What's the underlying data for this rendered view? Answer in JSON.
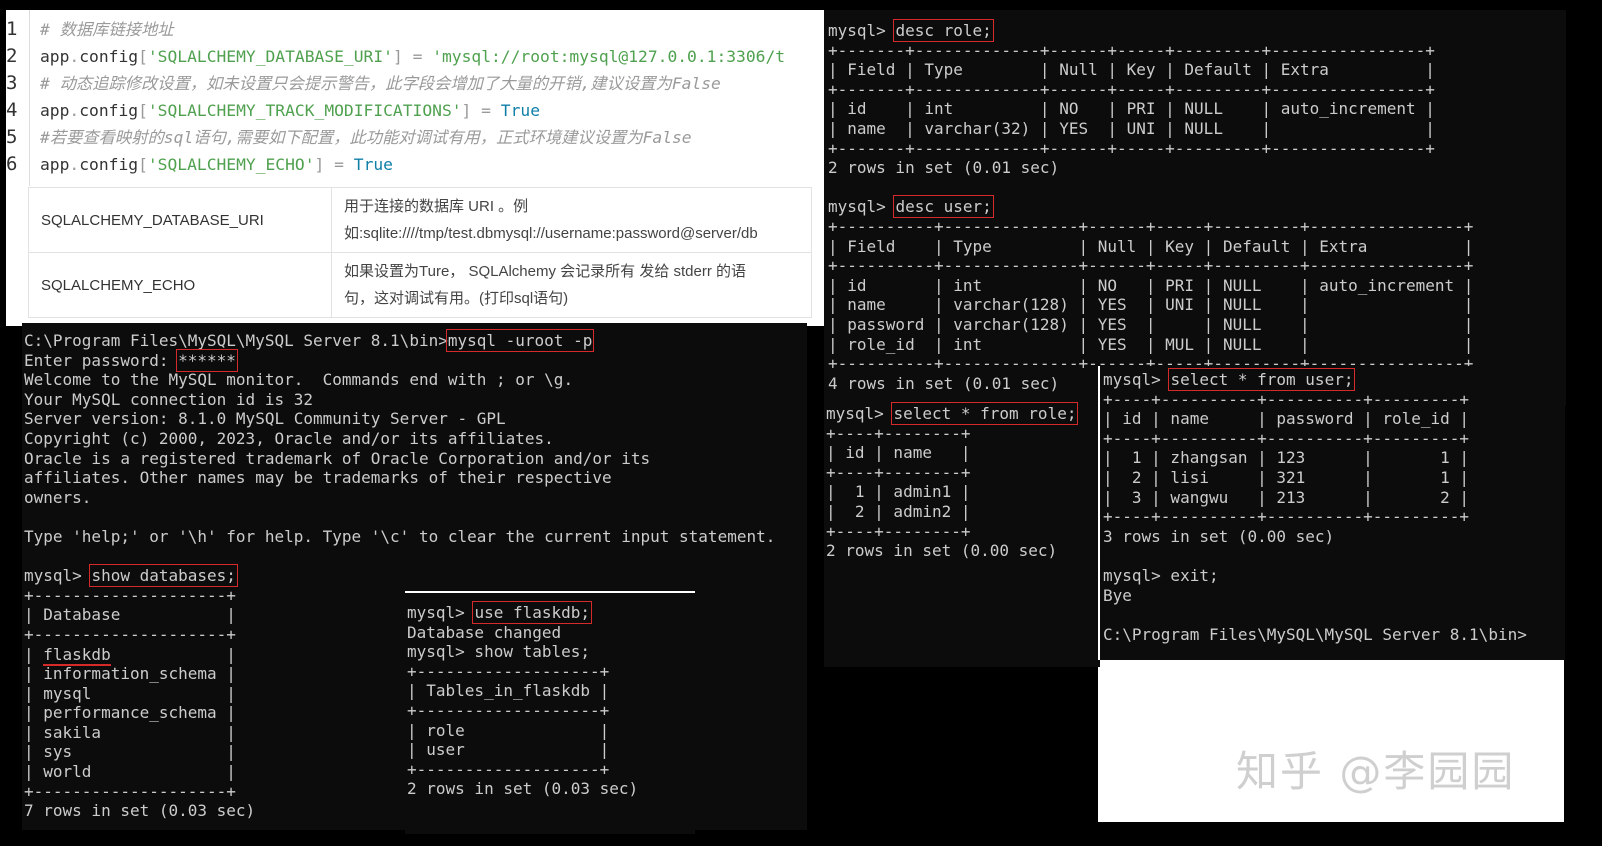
{
  "code": {
    "lines": [
      {
        "n": "1",
        "parts": [
          {
            "c": "c",
            "t": "# 数据库链接地址"
          }
        ]
      },
      {
        "n": "2",
        "parts": [
          {
            "c": "k",
            "t": "app"
          },
          {
            "c": "p",
            "t": "."
          },
          {
            "c": "k",
            "t": "config"
          },
          {
            "c": "p",
            "t": "["
          },
          {
            "c": "s",
            "t": "'SQLALCHEMY_DATABASE_URI'"
          },
          {
            "c": "p",
            "t": "]"
          },
          {
            "c": "k",
            "t": " "
          },
          {
            "c": "p",
            "t": "="
          },
          {
            "c": "k",
            "t": " "
          },
          {
            "c": "s",
            "t": "'mysql://root:mysql@127.0.0.1:3306/t"
          }
        ]
      },
      {
        "n": "3",
        "parts": [
          {
            "c": "c",
            "t": "# 动态追踪修改设置，如未设置只会提示警告，此字段会增加了大量的开销,建议设置为False"
          }
        ]
      },
      {
        "n": "4",
        "parts": [
          {
            "c": "k",
            "t": "app"
          },
          {
            "c": "p",
            "t": "."
          },
          {
            "c": "k",
            "t": "config"
          },
          {
            "c": "p",
            "t": "["
          },
          {
            "c": "s",
            "t": "'SQLALCHEMY_TRACK_MODIFICATIONS'"
          },
          {
            "c": "p",
            "t": "]"
          },
          {
            "c": "k",
            "t": " "
          },
          {
            "c": "p",
            "t": "="
          },
          {
            "c": "k",
            "t": " "
          },
          {
            "c": "b",
            "t": "True"
          }
        ]
      },
      {
        "n": "5",
        "parts": [
          {
            "c": "c",
            "t": "#若要查看映射的sql语句,需要如下配置，此功能对调试有用，正式环境建议设置为False"
          }
        ]
      },
      {
        "n": "6",
        "parts": [
          {
            "c": "k",
            "t": "app"
          },
          {
            "c": "p",
            "t": "."
          },
          {
            "c": "k",
            "t": "config"
          },
          {
            "c": "p",
            "t": "["
          },
          {
            "c": "s",
            "t": "'SQLALCHEMY_ECHO'"
          },
          {
            "c": "p",
            "t": "]"
          },
          {
            "c": "k",
            "t": " "
          },
          {
            "c": "p",
            "t": "="
          },
          {
            "c": "k",
            "t": " "
          },
          {
            "c": "b",
            "t": "True"
          }
        ]
      }
    ]
  },
  "config_table": [
    {
      "key": "SQLALCHEMY_DATABASE_URI",
      "desc1": "用于连接的数据库 URI 。例",
      "desc2": "如:sqlite:////tmp/test.dbmysql://username:password@server/db"
    },
    {
      "key": "SQLALCHEMY_ECHO",
      "desc1": "如果设置为Ture， SQLAlchemy 会记录所有 发给 stderr 的语",
      "desc2": "句，这对调试有用。(打印sql语句)"
    }
  ],
  "terminals": {
    "login": [
      {
        "t": "C:\\Program Files\\MySQL\\MySQL Server 8.1\\bin>",
        "h": "mysql -uroot -p"
      },
      {
        "t": "Enter password: ",
        "h": "******"
      },
      {
        "t": "Welcome to the MySQL monitor.  Commands end with ; or \\g."
      },
      {
        "t": "Your MySQL connection id is 32"
      },
      {
        "t": "Server version: 8.1.0 MySQL Community Server - GPL"
      },
      {
        "t": "Copyright (c) 2000, 2023, Oracle and/or its affiliates."
      },
      {
        "t": "Oracle is a registered trademark of Oracle Corporation and/or its"
      },
      {
        "t": "affiliates. Other names may be trademarks of their respective"
      },
      {
        "t": "owners."
      },
      {
        "t": ""
      },
      {
        "t": "Type 'help;' or '\\h' for help. Type '\\c' to clear the current input statement."
      },
      {
        "t": ""
      },
      {
        "t": "mysql> ",
        "h": "show databases;"
      },
      {
        "t": "+--------------------+"
      },
      {
        "t": "| Database           |"
      },
      {
        "t": "+--------------------+"
      },
      {
        "t": "| ",
        "u": "flaskdb",
        "r": "            |"
      },
      {
        "t": "| information_schema |"
      },
      {
        "t": "| mysql              |"
      },
      {
        "t": "| performance_schema |"
      },
      {
        "t": "| sakila             |"
      },
      {
        "t": "| sys                |"
      },
      {
        "t": "| world              |"
      },
      {
        "t": "+--------------------+"
      },
      {
        "t": "7 rows in set (0.03 sec)"
      }
    ],
    "tables": [
      {
        "t": "mysql> ",
        "h": "use flaskdb;"
      },
      {
        "t": "Database changed"
      },
      {
        "t": "mysql> show tables;"
      },
      {
        "t": "+-------------------+"
      },
      {
        "t": "| Tables_in_flaskdb |"
      },
      {
        "t": "+-------------------+"
      },
      {
        "t": "| role              |"
      },
      {
        "t": "| user              |"
      },
      {
        "t": "+-------------------+"
      },
      {
        "t": "2 rows in set (0.03 sec)"
      }
    ],
    "desc": [
      {
        "t": "mysql> ",
        "h": "desc role;"
      },
      {
        "t": "+-------+-------------+------+-----+---------+----------------+"
      },
      {
        "t": "| Field | Type        | Null | Key | Default | Extra          |"
      },
      {
        "t": "+-------+-------------+------+-----+---------+----------------+"
      },
      {
        "t": "| id    | int         | NO   | PRI | NULL    | auto_increment |"
      },
      {
        "t": "| name  | varchar(32) | YES  | UNI | NULL    |                |"
      },
      {
        "t": "+-------+-------------+------+-----+---------+----------------+"
      },
      {
        "t": "2 rows in set (0.01 sec)"
      },
      {
        "t": ""
      },
      {
        "t": "mysql> ",
        "h": "desc user;"
      },
      {
        "t": "+----------+--------------+------+-----+---------+----------------+"
      },
      {
        "t": "| Field    | Type         | Null | Key | Default | Extra          |"
      },
      {
        "t": "+----------+--------------+------+-----+---------+----------------+"
      },
      {
        "t": "| id       | int          | NO   | PRI | NULL    | auto_increment |"
      },
      {
        "t": "| name     | varchar(128) | YES  | UNI | NULL    |                |"
      },
      {
        "t": "| password | varchar(128) | YES  |     | NULL    |                |"
      },
      {
        "t": "| role_id  | int          | YES  | MUL | NULL    |                |"
      },
      {
        "t": "+----------+--------------+------+-----+---------+----------------+"
      },
      {
        "t": "4 rows in set (0.01 sec)"
      }
    ],
    "select_role": [
      {
        "t": "mysql> ",
        "h": "select * from role;"
      },
      {
        "t": "+----+--------+"
      },
      {
        "t": "| id | name   |"
      },
      {
        "t": "+----+--------+"
      },
      {
        "t": "|  1 | admin1 |"
      },
      {
        "t": "|  2 | admin2 |"
      },
      {
        "t": "+----+--------+"
      },
      {
        "t": "2 rows in set (0.00 sec)"
      }
    ],
    "select_user": [
      {
        "t": "mysql> ",
        "h": "select * from user;"
      },
      {
        "t": "+----+----------+----------+---------+"
      },
      {
        "t": "| id | name     | password | role_id |"
      },
      {
        "t": "+----+----------+----------+---------+"
      },
      {
        "t": "|  1 | zhangsan | 123      |       1 |"
      },
      {
        "t": "|  2 | lisi     | 321      |       1 |"
      },
      {
        "t": "|  3 | wangwu   | 213      |       2 |"
      },
      {
        "t": "+----+----------+----------+---------+"
      },
      {
        "t": "3 rows in set (0.00 sec)"
      },
      {
        "t": ""
      },
      {
        "t": "mysql> exit;"
      },
      {
        "t": "Bye"
      },
      {
        "t": ""
      },
      {
        "t": "C:\\Program Files\\MySQL\\MySQL Server 8.1\\bin>"
      }
    ]
  },
  "watermark": "知乎 @李园园"
}
